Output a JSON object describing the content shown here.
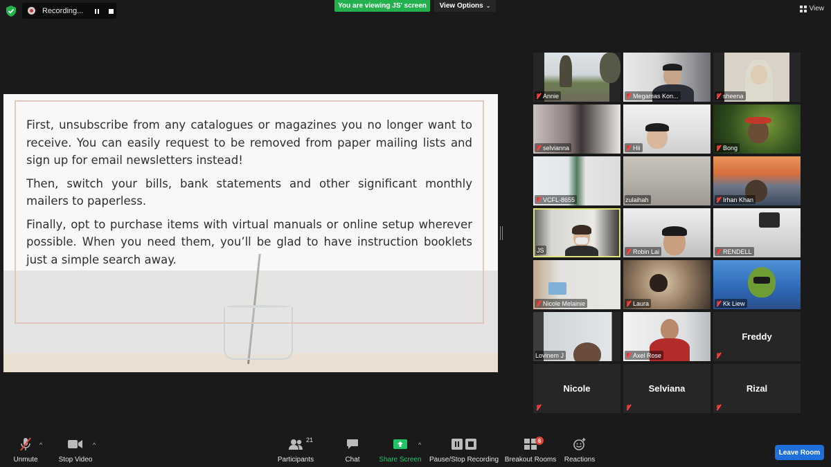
{
  "top_bar": {
    "recording_label": "Recording...",
    "viewing_banner": "You are viewing JS' screen",
    "view_options_label": "View Options",
    "view_label": "View"
  },
  "shared_screen": {
    "paragraphs": [
      "First, unsubscribe from any catalogues or magazines you no longer want to receive. You can easily request to be removed from paper mailing lists and sign up for email newsletters instead!",
      "Then, switch your bills, bank statements and other significant monthly mailers to paperless.",
      "Finally, opt to purchase items with virtual manuals or online setup wherever possible. When you need them, you’ll be glad to have instruction booklets just a simple search away."
    ]
  },
  "participants": [
    {
      "name": "Annie",
      "video": true,
      "muted": true
    },
    {
      "name": "Megamas Kon...",
      "video": true,
      "muted": true
    },
    {
      "name": "sheena",
      "video": true,
      "muted": true
    },
    {
      "name": "selvianna",
      "video": true,
      "muted": true
    },
    {
      "name": "Hii",
      "video": true,
      "muted": true
    },
    {
      "name": "Bong",
      "video": true,
      "muted": true
    },
    {
      "name": "VCFL-8655",
      "video": true,
      "muted": true
    },
    {
      "name": "zulaihah",
      "video": true,
      "muted": false
    },
    {
      "name": "Irhan Khan",
      "video": true,
      "muted": true
    },
    {
      "name": "JS",
      "video": true,
      "muted": false,
      "active_speaker": true
    },
    {
      "name": "Robin Lai",
      "video": true,
      "muted": true
    },
    {
      "name": "RENDELL",
      "video": true,
      "muted": true
    },
    {
      "name": "Nicole Melainie",
      "video": true,
      "muted": true
    },
    {
      "name": "Laura",
      "video": true,
      "muted": true
    },
    {
      "name": "Kk Liew",
      "video": true,
      "muted": true
    },
    {
      "name": "Lovinem J",
      "video": true,
      "muted": false
    },
    {
      "name": "Axel Rose",
      "video": true,
      "muted": true
    },
    {
      "name": "Freddy",
      "video": false,
      "muted": true
    },
    {
      "name": "Nicole",
      "video": false,
      "muted": true
    },
    {
      "name": "Selviana",
      "video": false,
      "muted": true
    },
    {
      "name": "Rizal",
      "video": false,
      "muted": true
    }
  ],
  "toolbar": {
    "unmute_label": "Unmute",
    "stop_video_label": "Stop Video",
    "participants_label": "Participants",
    "participants_count": "21",
    "chat_label": "Chat",
    "share_screen_label": "Share Screen",
    "pause_stop_recording_label": "Pause/Stop Recording",
    "breakout_rooms_label": "Breakout Rooms",
    "breakout_rooms_badge": "6",
    "reactions_label": "Reactions",
    "leave_room_label": "Leave Room"
  },
  "colors": {
    "share_green": "#23b14d",
    "leave_blue": "#1e6fd9",
    "active_speaker_border": "#e2e77c",
    "muted_red": "#dd3333"
  }
}
